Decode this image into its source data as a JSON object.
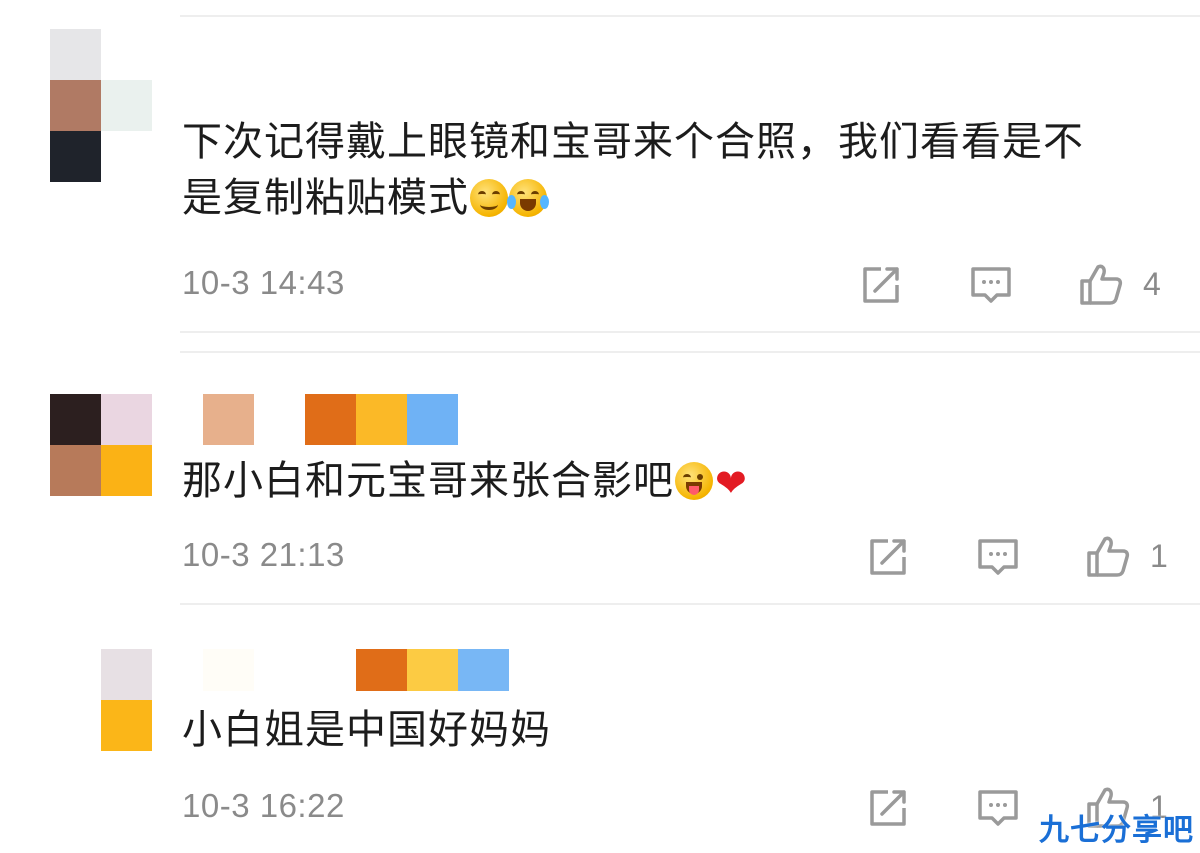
{
  "comments": [
    {
      "text": "下次记得戴上眼镜和宝哥来个合照，我们看看是不",
      "text_line2": "是复制粘贴模式",
      "emojis": [
        "grin-squint-icon",
        "laugh-cry-icon"
      ],
      "time": "10-3 14:43",
      "likes": "4",
      "avatar_colors": [
        "#e6e6e8",
        "#b07a64",
        "#1f232b",
        "#eaf1ee"
      ]
    },
    {
      "text": "那小白和元宝哥来张合影吧",
      "emojis": [
        "tongue-wink-icon",
        "red-heart-icon"
      ],
      "time": "10-3 21:13",
      "likes": "1",
      "avatar_colors": [
        "#2c1f1f",
        "#ead6e1",
        "#b77a5a",
        "#fbb215"
      ],
      "name_colors": [
        "#e7b08c",
        "#e06d18",
        "#fbb927",
        "#6fb2f5"
      ]
    },
    {
      "text": "小白姐是中国好妈妈",
      "emojis": [],
      "time": "10-3 16:22",
      "likes": "1",
      "avatar_colors": [
        "#ffffff",
        "#e7e0e4",
        "#ffffff",
        "#fbb618"
      ],
      "name_colors": [
        "#fffdf7",
        "#e06d18",
        "#fccb43",
        "#78b7f5"
      ]
    }
  ],
  "icons": {
    "share": "share-icon",
    "reply": "comment-icon",
    "like": "thumbs-up-icon"
  },
  "watermark": "九七分享吧"
}
